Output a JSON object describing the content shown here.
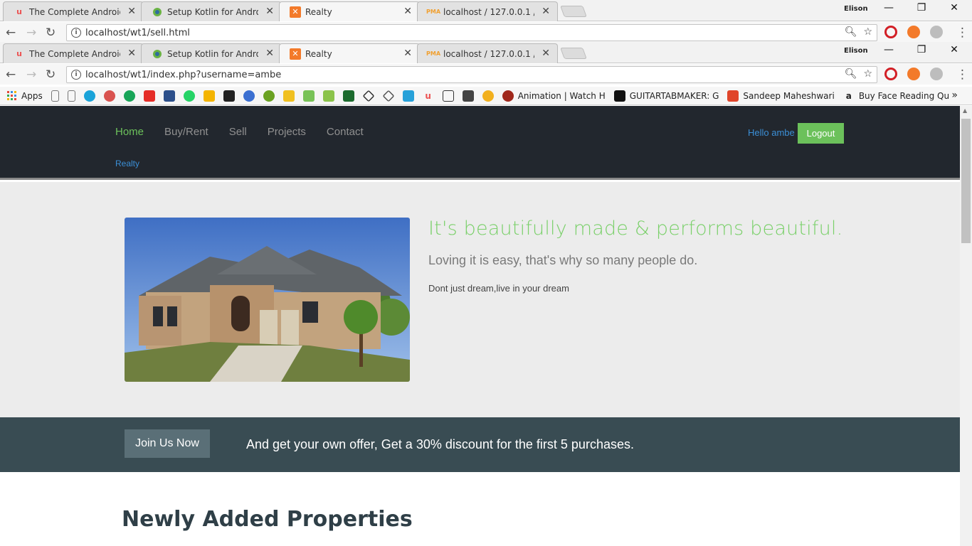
{
  "outer_window": {
    "tabs": [
      {
        "title": "The Complete Android D",
        "favicon": "udemy-icon"
      },
      {
        "title": "Setup Kotlin for Android",
        "favicon": "android-studio-icon"
      },
      {
        "title": "Realty",
        "favicon": "xampp-icon"
      },
      {
        "title": "localhost / 127.0.0.1 / wt",
        "favicon": "phpmyadmin-icon"
      }
    ],
    "profile_name": "Elison",
    "url": "localhost/wt1/sell.html"
  },
  "inner_window": {
    "tabs": [
      {
        "title": "The Complete Android D",
        "favicon": "udemy-icon"
      },
      {
        "title": "Setup Kotlin for Android",
        "favicon": "android-studio-icon"
      },
      {
        "title": "Realty",
        "favicon": "xampp-icon"
      },
      {
        "title": "localhost / 127.0.0.1 / wt",
        "favicon": "phpmyadmin-icon"
      }
    ],
    "profile_name": "Elison",
    "url": "localhost/wt1/index.php?username=ambe"
  },
  "bookmarks": {
    "apps_label": "Apps",
    "items": [
      {
        "label": "Animation | Watch H"
      },
      {
        "label": "GUITARTABMAKER: G"
      },
      {
        "label": "Sandeep Maheshwari"
      },
      {
        "label": "Buy Face Reading Qu"
      }
    ],
    "more": "»"
  },
  "site": {
    "nav": {
      "items": [
        "Home",
        "Buy/Rent",
        "Sell",
        "Projects",
        "Contact"
      ],
      "active": "Home",
      "brand": "Realty",
      "greeting": "Hello ambe",
      "logout_label": "Logout"
    },
    "hero": {
      "title": "It's beautifully made & performs beautiful.",
      "subtitle": "Loving it is easy, that's why so many people do.",
      "text": "Dont just dream,live in your dream"
    },
    "offer": {
      "button_label": "Join Us Now",
      "text": "And get your own offer, Get a 30% discount for the first 5 purchases."
    },
    "section_title": "Newly Added Properties"
  },
  "colors": {
    "accent_green": "#6cc15b",
    "link_blue": "#3b8fd6",
    "nav_bg": "#22272e",
    "offer_bg": "#394c53"
  }
}
